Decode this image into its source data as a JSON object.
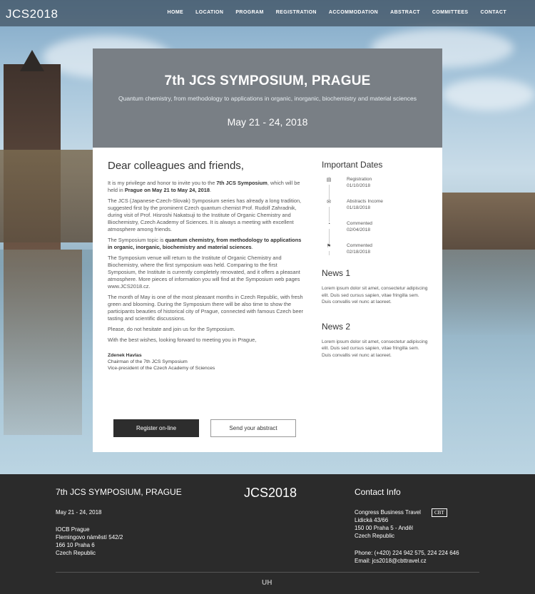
{
  "nav": {
    "logo": "JCS2018",
    "items": [
      "HOME",
      "LOCATION",
      "PROGRAM",
      "REGISTRATION",
      "ACCOMMODATION",
      "ABSTRACT",
      "COMMITTEES",
      "CONTACT"
    ]
  },
  "hero": {
    "title": "7th JCS SYMPOSIUM, PRAGUE",
    "subtitle": "Quantum chemistry, from methodology to applications in organic, inorganic, biochemistry and material sciences",
    "dates": "May 21 - 24, 2018"
  },
  "main": {
    "heading": "Dear colleagues and friends,",
    "p1a": "It is my privilege and honor to invite you to the ",
    "p1b": "7th JCS Symposium",
    "p1c": ", which will be held in ",
    "p1d": "Prague on May 21 to May 24, 2018",
    "p1e": ".",
    "p2": "The JCS (Japanese-Czech-Slovak) Symposium series has already a long tradition, suggested first by the prominent Czech quantum chemist Prof. Rudolf Zahradnik, during visit of Prof. Hisroshi Nakatsuji to the Institute of Organic Chemistry and Biochemistry, Czech Academy of Sciences. It is always a meeting with excellent atmosphere among friends.",
    "p3a": "The Symposium topic is ",
    "p3b": "quantum chemistry, from methodology to applications in organic, inorganic, biochemistry and material sciences",
    "p3c": ".",
    "p4": "The Symposium venue will return to the Institute of Organic Chemistry and Biochemistry, where the first symposium was held. Comparing to the first Symposium, the Institute is currently completely renovated, and it offers a pleasant atmosphere. More pieces of information you will find at the Symposium web pages www.JCS2018.cz.",
    "p5": "The month of May is one of the most pleasant months in Czech Republic, with fresh green and blooming. During the Symposium there will be also time to show the participants beauties of historical city of Prague, connected with famous Czech beer tasting and scientific discussions.",
    "p6": "Please, do not hesitate and join us for the Symposium.",
    "p7": "With the best wishes, looking forward to meeting you in Prague,",
    "sig_name": "Zdenek Havlas",
    "sig_line1": "Chairman of the 7th JCS Symposium",
    "sig_line2": "Vice-president of the Czech Academy of Sciences",
    "register_label": "Register on-line",
    "abstract_label": "Send your abstract"
  },
  "side": {
    "dates_title": "Important Dates",
    "dates": [
      {
        "label": "Registration",
        "date": "01/10/2018",
        "icon": "calendar-icon"
      },
      {
        "label": "Abstracts Income",
        "date": "01/18/2018",
        "icon": "envelope-icon"
      },
      {
        "label": "Commented",
        "date": "02/04/2018",
        "icon": "comment-icon"
      },
      {
        "label": "Commented",
        "date": "02/18/2018",
        "icon": "flag-icon"
      }
    ],
    "news1_title": "News 1",
    "news1_text": "Lorem ipsum dolor sit amet, consectetur adipiscing elit. Duis sed cursus sapien, vitae fringilla sem. Duis convallis vel nunc at laoreet.",
    "news2_title": "News 2",
    "news2_text": "Lorem ipsum dolor sit amet, consectetur adipiscing elit. Duis sed cursus sapien, vitae fringilla sem. Duis convallis vel nunc at laoreet."
  },
  "footer": {
    "title": "7th JCS SYMPOSIUM, PRAGUE",
    "dates": "May 21 - 24, 2018",
    "addr1": "IOCB Prague",
    "addr2": "Flemingovo náměstí 542/2",
    "addr3": "166 10 Praha 6",
    "addr4": "Czech Republic",
    "logo": "JCS2018",
    "contact_title": "Contact Info",
    "c1": "Congress Business Travel",
    "cbt": "CBT",
    "c2": "Lidická 43/66",
    "c3": "150 00 Praha 5 - Anděl",
    "c4": "Czech Republic",
    "phone": "Phone: (+420) 224 942 575, 224 224 646",
    "email": "Email: jcs2018@cbttravel.cz",
    "mark": "UH"
  }
}
